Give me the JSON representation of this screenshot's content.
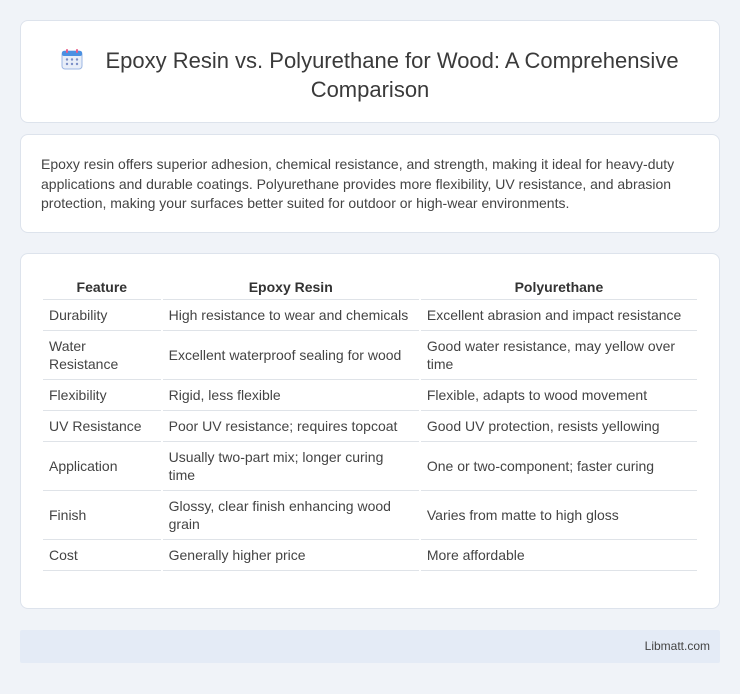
{
  "header": {
    "icon": "calendar-icon",
    "title": "Epoxy Resin vs. Polyurethane for Wood: A Comprehensive Comparison"
  },
  "intro": {
    "text": "Epoxy resin offers superior adhesion, chemical resistance, and strength, making it ideal for heavy-duty applications and durable coatings. Polyurethane provides more flexibility, UV resistance, and abrasion protection, making your surfaces better suited for outdoor or high-wear environments."
  },
  "table": {
    "headers": [
      "Feature",
      "Epoxy Resin",
      "Polyurethane"
    ],
    "rows": [
      [
        "Durability",
        "High resistance to wear and chemicals",
        "Excellent abrasion and impact resistance"
      ],
      [
        "Water Resistance",
        "Excellent waterproof sealing for wood",
        "Good water resistance, may yellow over time"
      ],
      [
        "Flexibility",
        "Rigid, less flexible",
        "Flexible, adapts to wood movement"
      ],
      [
        "UV Resistance",
        "Poor UV resistance; requires topcoat",
        "Good UV protection, resists yellowing"
      ],
      [
        "Application",
        "Usually two-part mix; longer curing time",
        "One or two-component; faster curing"
      ],
      [
        "Finish",
        "Glossy, clear finish enhancing wood grain",
        "Varies from matte to high gloss"
      ],
      [
        "Cost",
        "Generally higher price",
        "More affordable"
      ]
    ]
  },
  "footer": {
    "brand": "Libmatt.com"
  },
  "colors": {
    "page_bg": "#f0f3f8",
    "card_bg": "#ffffff",
    "footer_bg": "#e4ebf6",
    "icon_blue": "#4a90e2",
    "icon_pink": "#e85d8a"
  }
}
